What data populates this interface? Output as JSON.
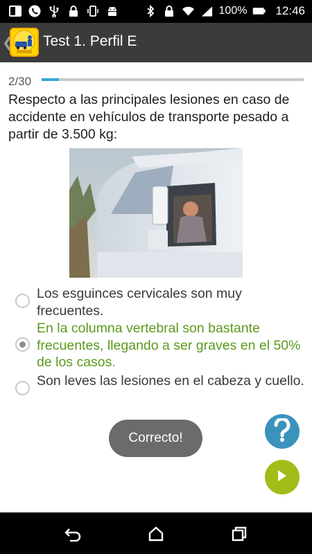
{
  "status_bar": {
    "battery_percent": "100%",
    "time": "12:46"
  },
  "app_bar": {
    "title": "Test 1. Perfil E"
  },
  "progress": {
    "label": "2/30",
    "fraction": 0.0667
  },
  "question": {
    "text": "Respecto a las principales lesiones en caso de accidente en vehículos de transporte pesado a partir de 3.500 kg:"
  },
  "options": [
    {
      "text": "Los esguinces cervicales son muy frecuentes.",
      "selected": false,
      "correct": false
    },
    {
      "text": "En la columna vertebral son bastante frecuentes, llegando a ser graves en el 50% de los casos.",
      "selected": true,
      "correct": true
    },
    {
      "text": "Son leves las lesiones en el cabeza y cuello.",
      "selected": false,
      "correct": false
    }
  ],
  "toast": {
    "text": "Correcto!"
  },
  "colors": {
    "correct_text": "#5b9a1e",
    "progress_fill": "#35a7d6",
    "help_button": "#3a93bd",
    "next_button": "#a2bd17",
    "app_bar": "#3b3b3b"
  },
  "icons": {
    "help": "question-mark-icon",
    "next": "play-arrow-icon",
    "nav": [
      "back-icon",
      "home-icon",
      "recents-icon"
    ]
  }
}
